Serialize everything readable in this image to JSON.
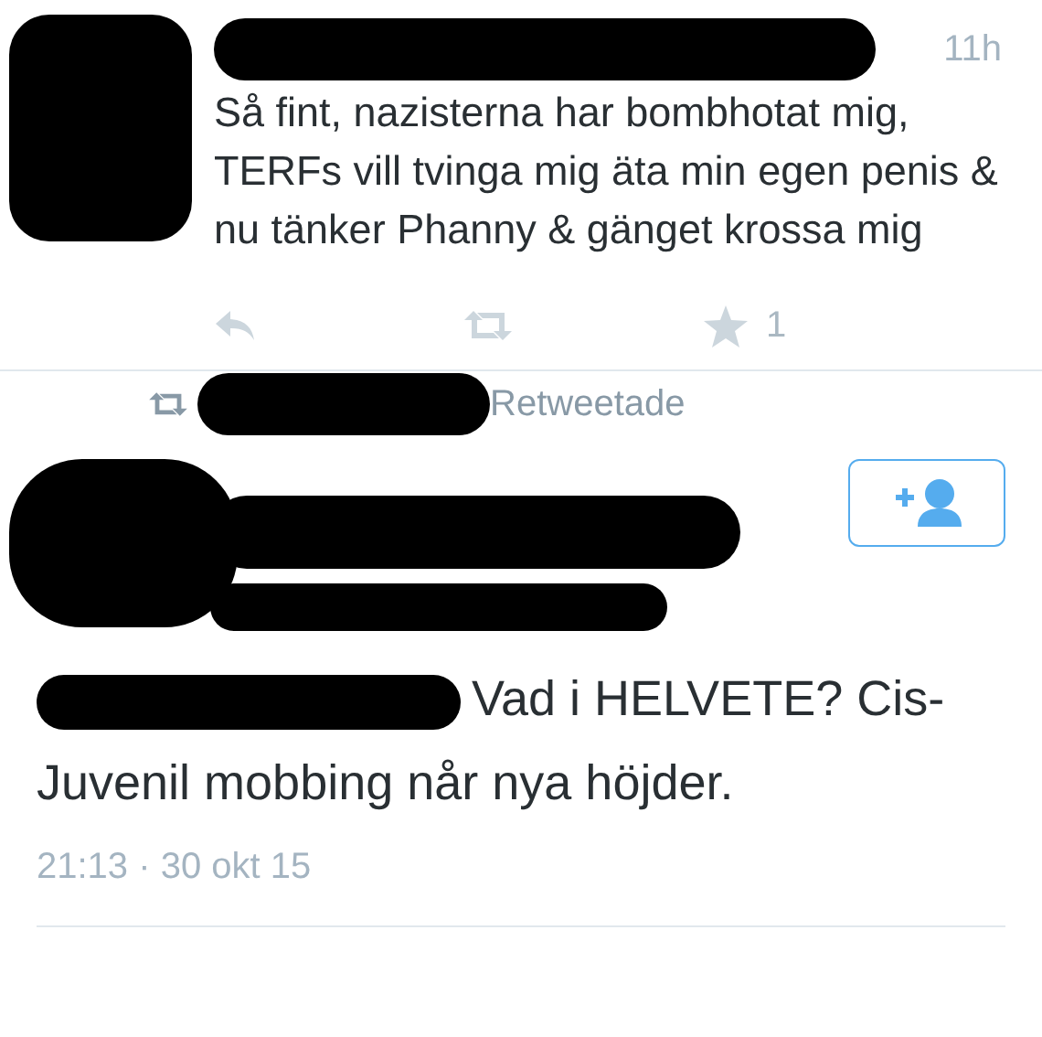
{
  "tweets": [
    {
      "kind": "reply",
      "time": "11h",
      "text": "Så fint, nazisterna har bombhotat mig, TERFs vill tvinga mig äta min egen penis & nu tänker Phanny & gänget krossa mig",
      "favorites": "1"
    },
    {
      "kind": "detail",
      "retweet_label": "Retweetade",
      "text": "Vad i HELVETE? Cis-Juvenil mobbing når nya höjder.",
      "timestamp": "21:13 · 30 okt 15"
    }
  ]
}
